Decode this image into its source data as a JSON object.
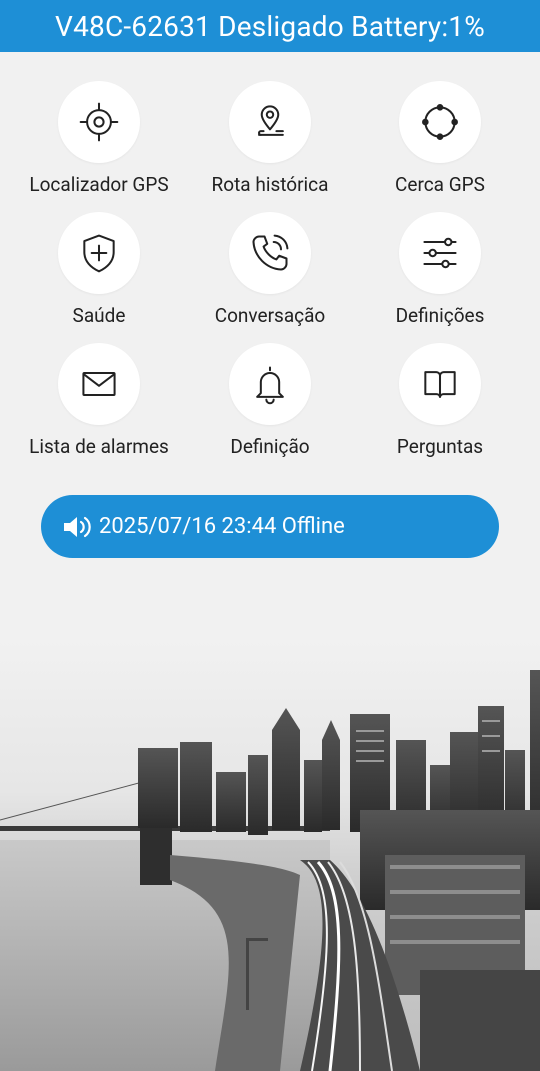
{
  "header": {
    "title": "V48C-62631 Desligado Battery:1%"
  },
  "menu": [
    {
      "label": "Localizador GPS",
      "icon": "crosshair-icon"
    },
    {
      "label": "Rota histórica",
      "icon": "map-pin-route-icon"
    },
    {
      "label": "Cerca GPS",
      "icon": "geofence-circle-icon"
    },
    {
      "label": "Saúde",
      "icon": "shield-plus-icon"
    },
    {
      "label": "Conversação",
      "icon": "phone-call-icon"
    },
    {
      "label": "Definições",
      "icon": "sliders-icon"
    },
    {
      "label": "Lista de alarmes",
      "icon": "envelope-icon"
    },
    {
      "label": "Definição",
      "icon": "bell-icon"
    },
    {
      "label": "Perguntas",
      "icon": "book-icon"
    }
  ],
  "status": {
    "text": "2025/07/16 23:44 Offline",
    "icon": "speaker-icon"
  },
  "colors": {
    "accent": "#1e8fd6",
    "background": "#f1f1f1"
  },
  "background_image": "grayscale-city-skyline"
}
